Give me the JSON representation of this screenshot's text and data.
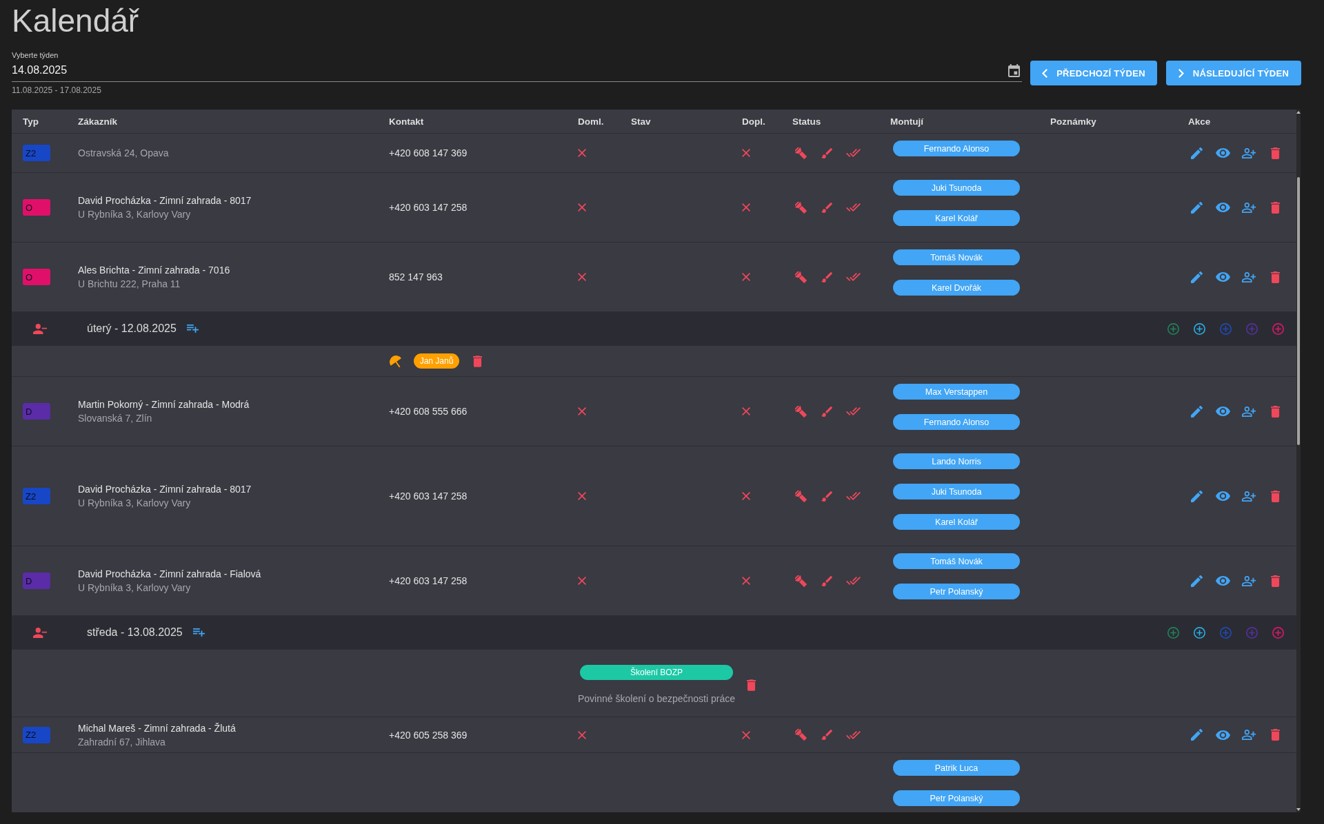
{
  "page": {
    "title": "Kalendář"
  },
  "week_picker": {
    "label": "Vyberte týden",
    "value": "14.08.2025",
    "range": "11.08.2025 - 17.08.2025"
  },
  "buttons": [
    {
      "label": "PŘEDCHOZÍ TÝDEN",
      "kind": "prev"
    },
    {
      "label": "NÁSLEDUJÍCÍ TÝDEN",
      "kind": "next"
    }
  ],
  "table": {
    "columns": [
      "Typ",
      "Zákazník",
      "Kontakt",
      "Doml.",
      "Stav",
      "Dopl.",
      "Status",
      "Montují",
      "Poznámky",
      "Akce"
    ],
    "rows": [
      {
        "kind": "order",
        "type": {
          "label": "Z2",
          "color": "#1747c6"
        },
        "address": "Ostravská 24, Opava",
        "contact": "+420 608 147 369",
        "doml": false,
        "dopl": false,
        "installers": [
          "Fernando Alonso"
        ]
      },
      {
        "kind": "order",
        "type": {
          "label": "O",
          "color": "#e0106a"
        },
        "customer": "David Procházka - Zimní zahrada - 8017",
        "address": "U Rybníka 3, Karlovy Vary",
        "contact": "+420 603 147 258",
        "doml": false,
        "dopl": false,
        "installers": [
          "Juki Tsunoda",
          "Karel Kolář"
        ]
      },
      {
        "kind": "order",
        "type": {
          "label": "O",
          "color": "#e0106a"
        },
        "customer": "Ales Brichta - Zimní zahrada - 7016",
        "address": "U Brichtu 222, Praha 11",
        "contact": "852 147 963",
        "doml": false,
        "dopl": false,
        "installers": [
          "Tomáš Novák",
          "Karel Dvořák"
        ]
      },
      {
        "kind": "day",
        "date": "úterý - 12.08.2025",
        "add_buttons": [
          {
            "color": "#23805a"
          },
          {
            "color": "#29abe2"
          },
          {
            "color": "#1f4ab8"
          },
          {
            "color": "#55309e"
          },
          {
            "color": "#d8186a"
          }
        ]
      },
      {
        "kind": "absence",
        "person": "Jan Janů"
      },
      {
        "kind": "order",
        "type": {
          "label": "D",
          "color": "#5a2ca8"
        },
        "customer": "Martin Pokorný - Zimní zahrada - Modrá",
        "address": "Slovanská 7, Zlín",
        "contact": "+420 608 555 666",
        "doml": false,
        "dopl": false,
        "installers": [
          "Max Verstappen",
          "Fernando Alonso"
        ]
      },
      {
        "kind": "order",
        "type": {
          "label": "Z2",
          "color": "#1747c6"
        },
        "customer": "David Procházka - Zimní zahrada - 8017",
        "address": "U Rybníka 3, Karlovy Vary",
        "contact": "+420 603 147 258",
        "doml": false,
        "dopl": false,
        "installers": [
          "Lando Norris",
          "Juki Tsunoda",
          "Karel Kolář"
        ]
      },
      {
        "kind": "order",
        "type": {
          "label": "D",
          "color": "#5a2ca8"
        },
        "customer": "David Procházka - Zimní zahrada - Fialová",
        "address": "U Rybníka 3, Karlovy Vary",
        "contact": "+420 603 147 258",
        "doml": false,
        "dopl": false,
        "installers": [
          "Tomáš Novák",
          "Petr Polanský"
        ]
      },
      {
        "kind": "day",
        "date": "středa - 13.08.2025",
        "add_buttons": [
          {
            "color": "#23805a"
          },
          {
            "color": "#29abe2"
          },
          {
            "color": "#1f4ab8"
          },
          {
            "color": "#55309e"
          },
          {
            "color": "#d8186a"
          }
        ]
      },
      {
        "kind": "event",
        "title": "Školení BOZP",
        "description": "Povinné školení o bezpečnosti práce"
      },
      {
        "kind": "order",
        "type": {
          "label": "Z2",
          "color": "#1747c6"
        },
        "customer": "Michal Mareš - Zimní zahrada - Žlutá",
        "address": "Zahradní 67, Jihlava",
        "contact": "+420 605 258 369",
        "doml": false,
        "dopl": false
      },
      {
        "kind": "installers",
        "installers": [
          "Patrik Luca",
          "Petr Polanský"
        ]
      }
    ]
  }
}
